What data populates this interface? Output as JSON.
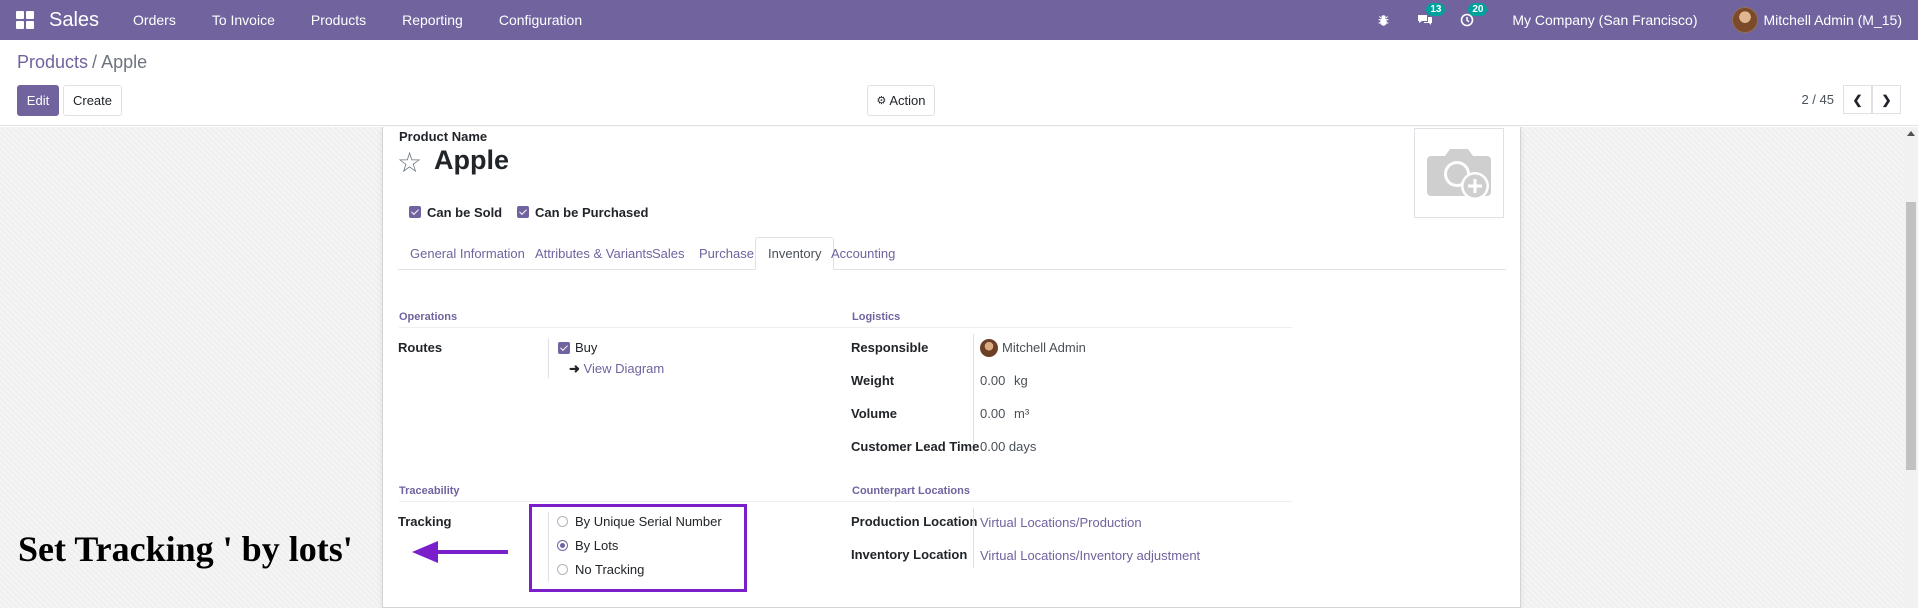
{
  "navbar": {
    "app_name": "Sales",
    "menu": [
      "Orders",
      "To Invoice",
      "Products",
      "Reporting",
      "Configuration"
    ],
    "messages_badge": "13",
    "activities_badge": "20",
    "company": "My Company (San Francisco)",
    "user": "Mitchell Admin (M_15)"
  },
  "control": {
    "breadcrumb_parent": "Products",
    "breadcrumb_sep": "/",
    "breadcrumb_current": "Apple",
    "edit_label": "Edit",
    "create_label": "Create",
    "action_label": "Action",
    "pager": "2 / 45"
  },
  "form": {
    "product_name_label": "Product Name",
    "product_name": "Apple",
    "can_be_sold": "Can be Sold",
    "can_be_purchased": "Can be Purchased",
    "tabs": [
      "General Information",
      "Attributes & Variants",
      "Sales",
      "Purchase",
      "Inventory",
      "Accounting"
    ],
    "active_tab": "Inventory"
  },
  "operations": {
    "title": "Operations",
    "routes_label": "Routes",
    "route_buy": "Buy",
    "view_diagram": "View Diagram"
  },
  "logistics": {
    "title": "Logistics",
    "responsible_label": "Responsible",
    "responsible": "Mitchell Admin",
    "weight_label": "Weight",
    "weight": "0.00",
    "weight_unit": "kg",
    "volume_label": "Volume",
    "volume": "0.00",
    "volume_unit": "m³",
    "lead_time_label": "Customer Lead Time",
    "lead_time": "0.00 days"
  },
  "traceability": {
    "title": "Traceability",
    "tracking_label": "Tracking",
    "options": [
      "By Unique Serial Number",
      "By Lots",
      "No Tracking"
    ],
    "selected": "By Lots"
  },
  "counterpart": {
    "title": "Counterpart Locations",
    "production_label": "Production Location",
    "production": "Virtual Locations/Production",
    "inventory_label": "Inventory Location",
    "inventory": "Virtual Locations/Inventory adjustment"
  },
  "annotation": {
    "text": "Set Tracking ' by lots'"
  },
  "colors": {
    "brand": "#71639e",
    "annotation": "#7a1fc9"
  }
}
